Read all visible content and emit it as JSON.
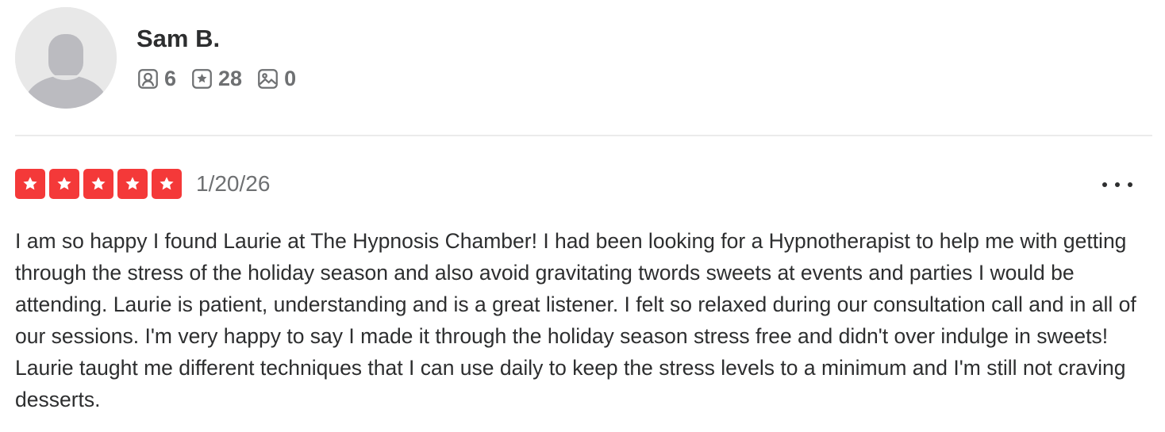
{
  "user": {
    "name": "Sam B.",
    "stats": {
      "friends": "6",
      "reviews": "28",
      "photos": "0"
    },
    "icons": {
      "avatar": "default-avatar-icon",
      "friends": "friends-icon",
      "reviews": "review-star-icon",
      "photos": "photo-icon"
    }
  },
  "review": {
    "rating": 5,
    "max_rating": 5,
    "date": "1/20/26",
    "text": "I am so happy I found Laurie at The Hypnosis Chamber! I had been looking for a Hypnotherapist to help me with getting through the stress of the holiday season and also avoid gravitating twords sweets at events and parties I would be attending. Laurie is patient, understanding and is a great listener. I felt so relaxed during our consultation call and in all of our sessions. I'm very happy to say I made it through the holiday season stress free and didn't over indulge in sweets! Laurie taught me different techniques that I can use daily to keep the stress levels to a minimum and I'm still not craving desserts."
  },
  "colors": {
    "star_fill": "#f43939",
    "text_primary": "#2d2e2f",
    "text_secondary": "#6e7072",
    "divider": "#ebebeb",
    "avatar_bg": "#e8e8e8",
    "avatar_silhouette": "#bbbbc0"
  },
  "menu": {
    "more_icon": "more-options-icon"
  }
}
